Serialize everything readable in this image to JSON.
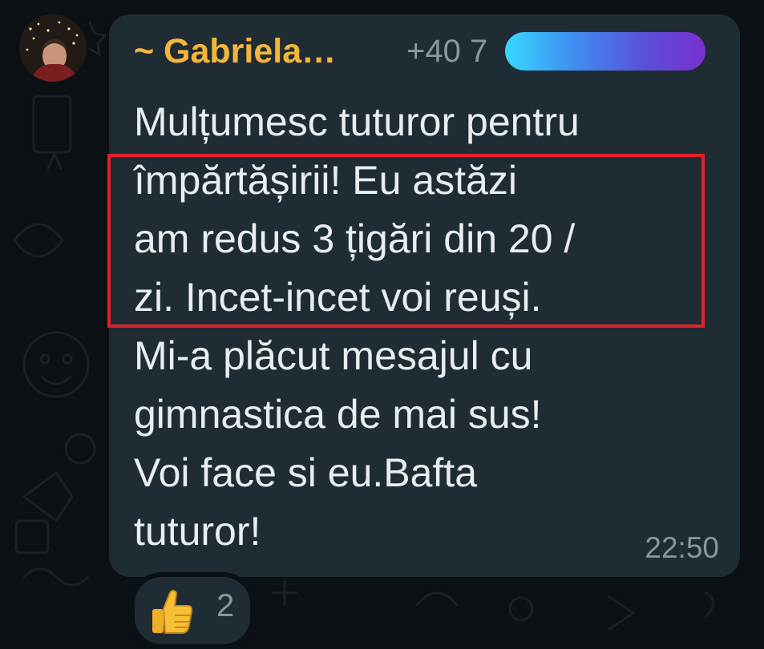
{
  "message": {
    "sender_name": "~ Gabriela…",
    "sender_phone_visible": "+40 7",
    "text_lines": [
      "Mulțumesc tuturor pentru",
      "împărtășirii! Eu astăzi",
      "am redus 3 țigări din 20 /",
      "zi. Incet-incet voi reuși.",
      "Mi-a plăcut mesajul cu",
      "gimnastica de mai sus!",
      "Voi face si eu.Bafta",
      "tuturor!"
    ],
    "time": "22:50"
  },
  "reaction": {
    "emoji_icon": "thumbs-up-icon",
    "count": "2"
  },
  "colors": {
    "sender_name": "#f4b63a",
    "bubble": "#202c33",
    "background": "#0b1014",
    "text": "#e9edef",
    "meta": "#8c969d",
    "highlight_box": "#e3202a"
  },
  "redaction": {
    "style": "gradient-blur-over-phone-number"
  }
}
